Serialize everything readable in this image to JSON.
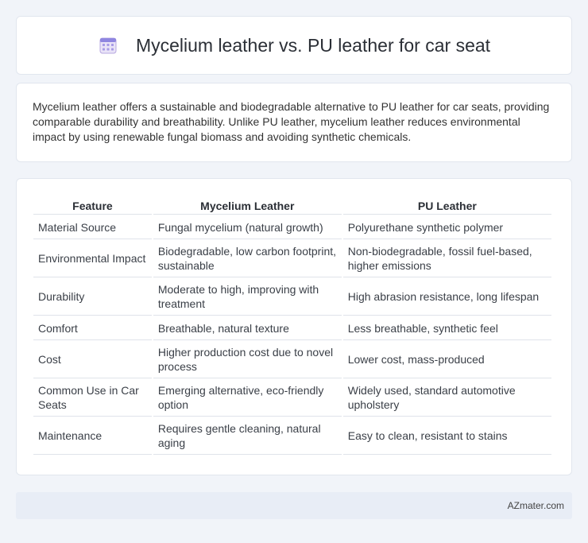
{
  "header": {
    "title": "Mycelium leather vs. PU leather for car seat",
    "icon": "calendar-icon"
  },
  "summary": "Mycelium leather offers a sustainable and biodegradable alternative to PU leather for car seats, providing comparable durability and breathability. Unlike PU leather, mycelium leather reduces environmental impact by using renewable fungal biomass and avoiding synthetic chemicals.",
  "table": {
    "headers": [
      "Feature",
      "Mycelium Leather",
      "PU Leather"
    ],
    "rows": [
      [
        "Material Source",
        "Fungal mycelium (natural growth)",
        "Polyurethane synthetic polymer"
      ],
      [
        "Environmental Impact",
        "Biodegradable, low carbon footprint, sustainable",
        "Non-biodegradable, fossil fuel-based, higher emissions"
      ],
      [
        "Durability",
        "Moderate to high, improving with treatment",
        "High abrasion resistance, long lifespan"
      ],
      [
        "Comfort",
        "Breathable, natural texture",
        "Less breathable, synthetic feel"
      ],
      [
        "Cost",
        "Higher production cost due to novel process",
        "Lower cost, mass-produced"
      ],
      [
        "Common Use in Car Seats",
        "Emerging alternative, eco-friendly option",
        "Widely used, standard automotive upholstery"
      ],
      [
        "Maintenance",
        "Requires gentle cleaning, natural aging",
        "Easy to clean, resistant to stains"
      ]
    ]
  },
  "footer": {
    "brand": "AZmater.com"
  }
}
